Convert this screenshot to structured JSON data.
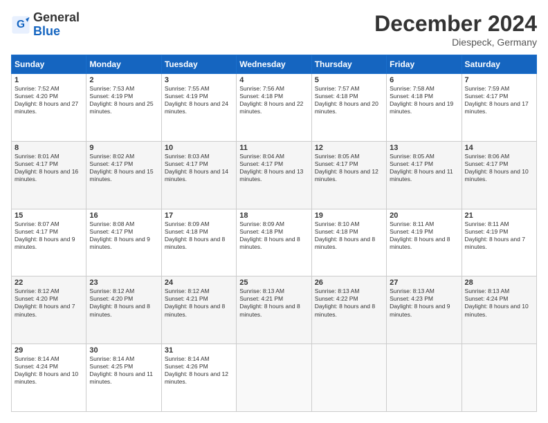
{
  "header": {
    "logo_general": "General",
    "logo_blue": "Blue",
    "month": "December 2024",
    "location": "Diespeck, Germany"
  },
  "days_of_week": [
    "Sunday",
    "Monday",
    "Tuesday",
    "Wednesday",
    "Thursday",
    "Friday",
    "Saturday"
  ],
  "weeks": [
    [
      {
        "day": "1",
        "sunrise": "Sunrise: 7:52 AM",
        "sunset": "Sunset: 4:20 PM",
        "daylight": "Daylight: 8 hours and 27 minutes."
      },
      {
        "day": "2",
        "sunrise": "Sunrise: 7:53 AM",
        "sunset": "Sunset: 4:19 PM",
        "daylight": "Daylight: 8 hours and 25 minutes."
      },
      {
        "day": "3",
        "sunrise": "Sunrise: 7:55 AM",
        "sunset": "Sunset: 4:19 PM",
        "daylight": "Daylight: 8 hours and 24 minutes."
      },
      {
        "day": "4",
        "sunrise": "Sunrise: 7:56 AM",
        "sunset": "Sunset: 4:18 PM",
        "daylight": "Daylight: 8 hours and 22 minutes."
      },
      {
        "day": "5",
        "sunrise": "Sunrise: 7:57 AM",
        "sunset": "Sunset: 4:18 PM",
        "daylight": "Daylight: 8 hours and 20 minutes."
      },
      {
        "day": "6",
        "sunrise": "Sunrise: 7:58 AM",
        "sunset": "Sunset: 4:18 PM",
        "daylight": "Daylight: 8 hours and 19 minutes."
      },
      {
        "day": "7",
        "sunrise": "Sunrise: 7:59 AM",
        "sunset": "Sunset: 4:17 PM",
        "daylight": "Daylight: 8 hours and 17 minutes."
      }
    ],
    [
      {
        "day": "8",
        "sunrise": "Sunrise: 8:01 AM",
        "sunset": "Sunset: 4:17 PM",
        "daylight": "Daylight: 8 hours and 16 minutes."
      },
      {
        "day": "9",
        "sunrise": "Sunrise: 8:02 AM",
        "sunset": "Sunset: 4:17 PM",
        "daylight": "Daylight: 8 hours and 15 minutes."
      },
      {
        "day": "10",
        "sunrise": "Sunrise: 8:03 AM",
        "sunset": "Sunset: 4:17 PM",
        "daylight": "Daylight: 8 hours and 14 minutes."
      },
      {
        "day": "11",
        "sunrise": "Sunrise: 8:04 AM",
        "sunset": "Sunset: 4:17 PM",
        "daylight": "Daylight: 8 hours and 13 minutes."
      },
      {
        "day": "12",
        "sunrise": "Sunrise: 8:05 AM",
        "sunset": "Sunset: 4:17 PM",
        "daylight": "Daylight: 8 hours and 12 minutes."
      },
      {
        "day": "13",
        "sunrise": "Sunrise: 8:05 AM",
        "sunset": "Sunset: 4:17 PM",
        "daylight": "Daylight: 8 hours and 11 minutes."
      },
      {
        "day": "14",
        "sunrise": "Sunrise: 8:06 AM",
        "sunset": "Sunset: 4:17 PM",
        "daylight": "Daylight: 8 hours and 10 minutes."
      }
    ],
    [
      {
        "day": "15",
        "sunrise": "Sunrise: 8:07 AM",
        "sunset": "Sunset: 4:17 PM",
        "daylight": "Daylight: 8 hours and 9 minutes."
      },
      {
        "day": "16",
        "sunrise": "Sunrise: 8:08 AM",
        "sunset": "Sunset: 4:17 PM",
        "daylight": "Daylight: 8 hours and 9 minutes."
      },
      {
        "day": "17",
        "sunrise": "Sunrise: 8:09 AM",
        "sunset": "Sunset: 4:18 PM",
        "daylight": "Daylight: 8 hours and 8 minutes."
      },
      {
        "day": "18",
        "sunrise": "Sunrise: 8:09 AM",
        "sunset": "Sunset: 4:18 PM",
        "daylight": "Daylight: 8 hours and 8 minutes."
      },
      {
        "day": "19",
        "sunrise": "Sunrise: 8:10 AM",
        "sunset": "Sunset: 4:18 PM",
        "daylight": "Daylight: 8 hours and 8 minutes."
      },
      {
        "day": "20",
        "sunrise": "Sunrise: 8:11 AM",
        "sunset": "Sunset: 4:19 PM",
        "daylight": "Daylight: 8 hours and 8 minutes."
      },
      {
        "day": "21",
        "sunrise": "Sunrise: 8:11 AM",
        "sunset": "Sunset: 4:19 PM",
        "daylight": "Daylight: 8 hours and 7 minutes."
      }
    ],
    [
      {
        "day": "22",
        "sunrise": "Sunrise: 8:12 AM",
        "sunset": "Sunset: 4:20 PM",
        "daylight": "Daylight: 8 hours and 7 minutes."
      },
      {
        "day": "23",
        "sunrise": "Sunrise: 8:12 AM",
        "sunset": "Sunset: 4:20 PM",
        "daylight": "Daylight: 8 hours and 8 minutes."
      },
      {
        "day": "24",
        "sunrise": "Sunrise: 8:12 AM",
        "sunset": "Sunset: 4:21 PM",
        "daylight": "Daylight: 8 hours and 8 minutes."
      },
      {
        "day": "25",
        "sunrise": "Sunrise: 8:13 AM",
        "sunset": "Sunset: 4:21 PM",
        "daylight": "Daylight: 8 hours and 8 minutes."
      },
      {
        "day": "26",
        "sunrise": "Sunrise: 8:13 AM",
        "sunset": "Sunset: 4:22 PM",
        "daylight": "Daylight: 8 hours and 8 minutes."
      },
      {
        "day": "27",
        "sunrise": "Sunrise: 8:13 AM",
        "sunset": "Sunset: 4:23 PM",
        "daylight": "Daylight: 8 hours and 9 minutes."
      },
      {
        "day": "28",
        "sunrise": "Sunrise: 8:13 AM",
        "sunset": "Sunset: 4:24 PM",
        "daylight": "Daylight: 8 hours and 10 minutes."
      }
    ],
    [
      {
        "day": "29",
        "sunrise": "Sunrise: 8:14 AM",
        "sunset": "Sunset: 4:24 PM",
        "daylight": "Daylight: 8 hours and 10 minutes."
      },
      {
        "day": "30",
        "sunrise": "Sunrise: 8:14 AM",
        "sunset": "Sunset: 4:25 PM",
        "daylight": "Daylight: 8 hours and 11 minutes."
      },
      {
        "day": "31",
        "sunrise": "Sunrise: 8:14 AM",
        "sunset": "Sunset: 4:26 PM",
        "daylight": "Daylight: 8 hours and 12 minutes."
      },
      null,
      null,
      null,
      null
    ]
  ]
}
